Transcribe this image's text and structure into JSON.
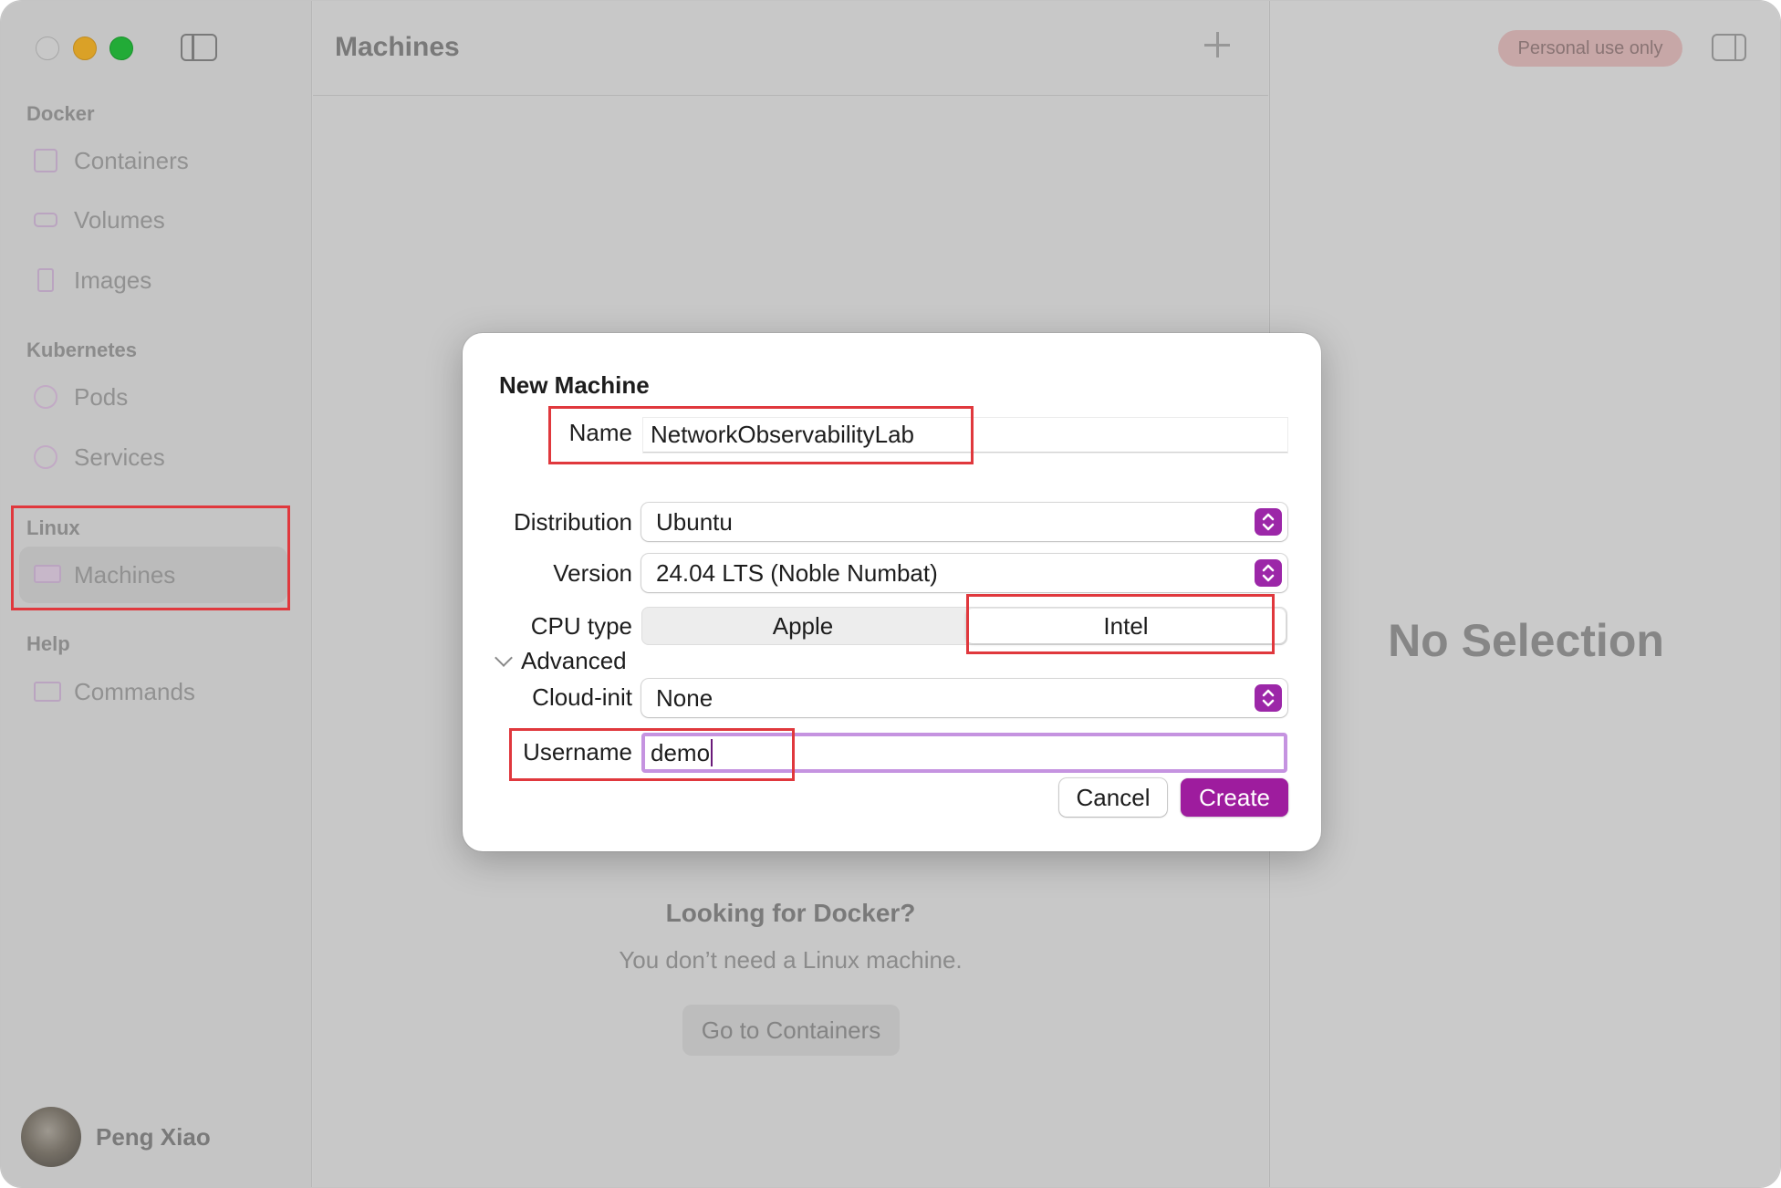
{
  "sidebar": {
    "sections": [
      {
        "label": "Docker",
        "items": [
          {
            "label": "Containers",
            "icon": "container-box-icon"
          },
          {
            "label": "Volumes",
            "icon": "drive-icon"
          },
          {
            "label": "Images",
            "icon": "image-layers-icon"
          }
        ]
      },
      {
        "label": "Kubernetes",
        "items": [
          {
            "label": "Pods",
            "icon": "helm-wheel-icon"
          },
          {
            "label": "Services",
            "icon": "network-globe-icon"
          }
        ]
      },
      {
        "label": "Linux",
        "items": [
          {
            "label": "Machines",
            "icon": "monitor-icon",
            "selected": true
          }
        ]
      },
      {
        "label": "Help",
        "items": [
          {
            "label": "Commands",
            "icon": "terminal-icon"
          }
        ]
      }
    ],
    "user": {
      "name": "Peng Xiao"
    }
  },
  "middle": {
    "title": "Machines",
    "empty_title": "Looking for Docker?",
    "empty_subtitle": "You don’t need a Linux machine.",
    "goto_label": "Go to Containers"
  },
  "right": {
    "badge": "Personal use only",
    "placeholder": "No Selection"
  },
  "dialog": {
    "title": "New Machine",
    "name_label": "Name",
    "name_value": "NetworkObservabilityLab",
    "distribution_label": "Distribution",
    "distribution_value": "Ubuntu",
    "version_label": "Version",
    "version_value": "24.04 LTS (Noble Numbat)",
    "cpu_label": "CPU type",
    "cpu_options": [
      "Apple",
      "Intel"
    ],
    "cpu_selected": "Intel",
    "advanced_label": "Advanced",
    "cloudinit_label": "Cloud-init",
    "cloudinit_value": "None",
    "username_label": "Username",
    "username_value": "demo",
    "cancel_label": "Cancel",
    "create_label": "Create"
  },
  "colors": {
    "accent": "#9e1c9e",
    "focus_ring": "#c593e0",
    "annotation": "#e0383d",
    "badge_bg": "#e8c3c3"
  }
}
